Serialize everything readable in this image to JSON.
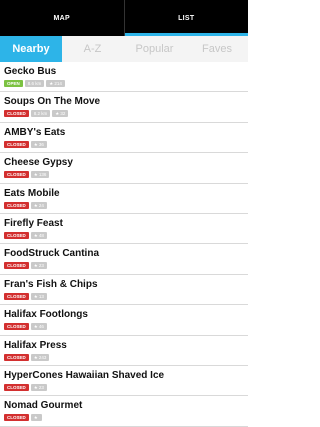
{
  "topbar": {
    "map_label": "MAP",
    "list_label": "LIST"
  },
  "tabs": [
    {
      "label": "Nearby"
    },
    {
      "label": "A-Z"
    },
    {
      "label": "Popular"
    },
    {
      "label": "Faves"
    }
  ],
  "items": [
    {
      "name": "Gecko Bus",
      "status": "OPEN",
      "distance": "8.6 km",
      "rating": "214"
    },
    {
      "name": "Soups On The Move",
      "status": "CLOSED",
      "distance": "8.2 km",
      "rating": "32"
    },
    {
      "name": "AMBY's Eats",
      "status": "CLOSED",
      "rating": "36"
    },
    {
      "name": "Cheese Gypsy",
      "status": "CLOSED",
      "rating": "136"
    },
    {
      "name": "Eats Mobile",
      "status": "CLOSED",
      "rating": "24"
    },
    {
      "name": "Firefly Feast",
      "status": "CLOSED",
      "rating": "48"
    },
    {
      "name": "FoodStruck Cantina",
      "status": "CLOSED",
      "rating": "23"
    },
    {
      "name": "Fran's Fish & Chips",
      "status": "CLOSED",
      "rating": "13"
    },
    {
      "name": "Halifax Footlongs",
      "status": "CLOSED",
      "rating": "46"
    },
    {
      "name": "Halifax Press",
      "status": "CLOSED",
      "rating": "243"
    },
    {
      "name": "HyperCones Hawaiian Shaved Ice",
      "status": "CLOSED",
      "rating": "23"
    },
    {
      "name": "Nomad Gourmet",
      "status": "CLOSED",
      "rating": ""
    }
  ],
  "icons": {
    "star": "star-icon"
  },
  "colors": {
    "accent": "#2db4e8",
    "open": "#7cc242",
    "closed": "#d32f2f",
    "pill": "#c9c9c9"
  }
}
